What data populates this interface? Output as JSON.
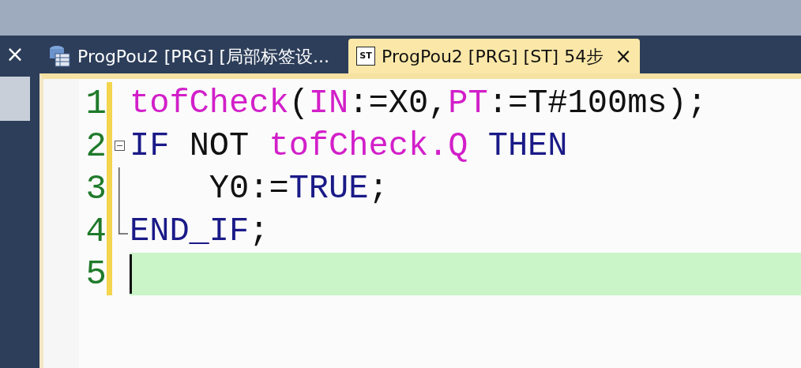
{
  "tabs": [
    {
      "label": "ProgPou2 [PRG] [局部标签设...",
      "kind": "table",
      "selected": false
    },
    {
      "label": "ProgPou2 [PRG] [ST] 54步",
      "kind": "st",
      "icon_text": "ST",
      "selected": true
    }
  ],
  "close_symbol": "×",
  "tab_close_symbol": "×",
  "editor": {
    "lines": [
      {
        "number": "1",
        "modified": true,
        "kind": "plain",
        "current": false,
        "tokens": [
          {
            "text": "tofCheck",
            "kind": "fb"
          },
          {
            "text": "(",
            "kind": "plain"
          },
          {
            "text": "IN",
            "kind": "fb"
          },
          {
            "text": ":=X0,",
            "kind": "plain"
          },
          {
            "text": "PT",
            "kind": "fb"
          },
          {
            "text": ":=T#100ms);",
            "kind": "plain"
          }
        ]
      },
      {
        "number": "2",
        "modified": true,
        "kind": "foldstart",
        "current": false,
        "tokens": [
          {
            "text": "IF",
            "kind": "keyword"
          },
          {
            "text": " NOT ",
            "kind": "plain"
          },
          {
            "text": "tofCheck.Q",
            "kind": "fb"
          },
          {
            "text": " THEN",
            "kind": "keyword"
          }
        ]
      },
      {
        "number": "3",
        "modified": true,
        "kind": "foldbody",
        "current": false,
        "tokens": [
          {
            "text": "    Y0:=",
            "kind": "plain"
          },
          {
            "text": "TRUE",
            "kind": "keyword"
          },
          {
            "text": ";",
            "kind": "plain"
          }
        ]
      },
      {
        "number": "4",
        "modified": true,
        "kind": "foldend",
        "current": false,
        "tokens": [
          {
            "text": "END_IF",
            "kind": "keyword"
          },
          {
            "text": ";",
            "kind": "plain"
          }
        ]
      },
      {
        "number": "5",
        "modified": true,
        "kind": "plain",
        "current": true
      }
    ]
  }
}
